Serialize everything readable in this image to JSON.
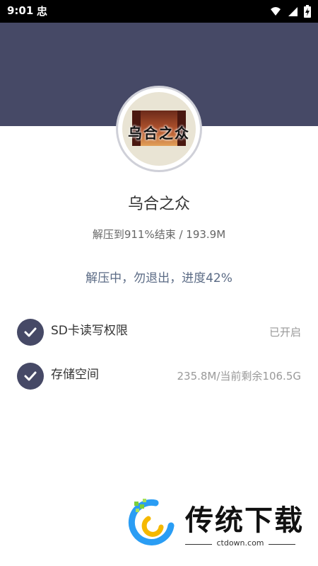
{
  "status_bar": {
    "time": "9:01",
    "app_icon": "忠"
  },
  "app": {
    "name": "乌合之众",
    "avatar_text": "乌合之众"
  },
  "extract": {
    "info": "解压到911%结束 / 193.9M",
    "progress_text": "解压中，勿退出，进度42%",
    "progress_percent": 42
  },
  "permissions": [
    {
      "label": "SD卡读写权限",
      "value": "已开启",
      "icon": "check-icon"
    },
    {
      "label": "存储空间",
      "value": "235.8M/当前剩余106.5G",
      "icon": "check-icon"
    }
  ],
  "watermark": {
    "brand": "传统下载",
    "site": "ctdown.com"
  },
  "colors": {
    "header": "#464966",
    "check_bg": "#464966",
    "progress_text": "#5b6b85"
  }
}
